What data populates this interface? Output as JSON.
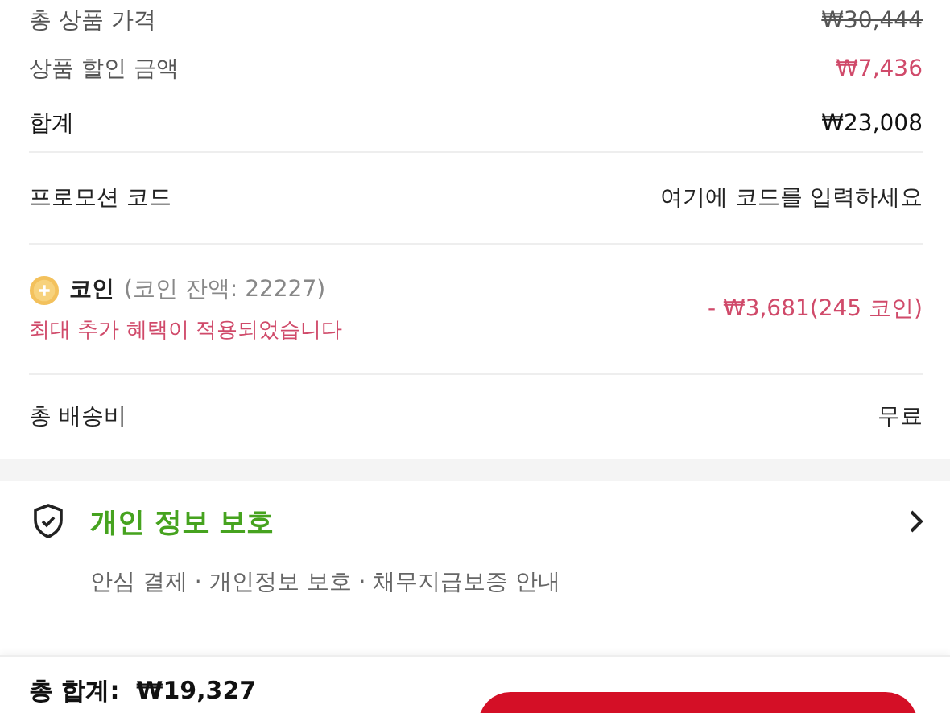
{
  "summary": [
    {
      "label": "총 상품 가격",
      "value": "₩30,444",
      "kind": "struck"
    },
    {
      "label": "상품 할인 금액",
      "value": "₩7,436",
      "kind": "discount"
    },
    {
      "label": "합계",
      "value": "₩23,008",
      "kind": "total"
    }
  ],
  "promo": {
    "label": "프로모션 코드",
    "placeholder": "여기에 코드를 입력하세요"
  },
  "coin": {
    "label": "코인",
    "balance": "(코인 잔액: 22227)",
    "notice": "최대 추가 혜택이 적용되었습니다",
    "amount": "- ₩3,681(245 코인)"
  },
  "shipping": {
    "label": "총 배송비",
    "value": "무료"
  },
  "privacy": {
    "title": "개인 정보 보호",
    "subtitle": "안심 결제 · 개인정보 보호 · 채무지급보증 안내"
  },
  "bottom_bar": {
    "total": "총 합계:  ₩19,327"
  }
}
